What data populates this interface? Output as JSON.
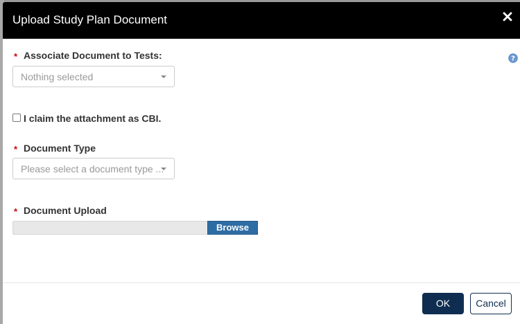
{
  "modal": {
    "title": "Upload Study Plan Document",
    "close_icon": "close-icon",
    "help_icon": "question-circle-icon"
  },
  "form": {
    "tests": {
      "required_marker": "*",
      "label": "Associate Document to Tests:",
      "value": "Nothing selected"
    },
    "cbi": {
      "label": "I claim the attachment as CBI.",
      "checked": false
    },
    "doc_type": {
      "required_marker": "*",
      "label": "Document Type",
      "placeholder": "Please select a document type ..."
    },
    "upload": {
      "required_marker": "*",
      "label": "Document Upload",
      "browse_label": "Browse"
    }
  },
  "footer": {
    "ok_label": "OK",
    "cancel_label": "Cancel"
  },
  "colors": {
    "header_bg": "#000000",
    "primary_button": "#0f2d50",
    "browse_button": "#2e6da4",
    "required": "#cc0000"
  }
}
